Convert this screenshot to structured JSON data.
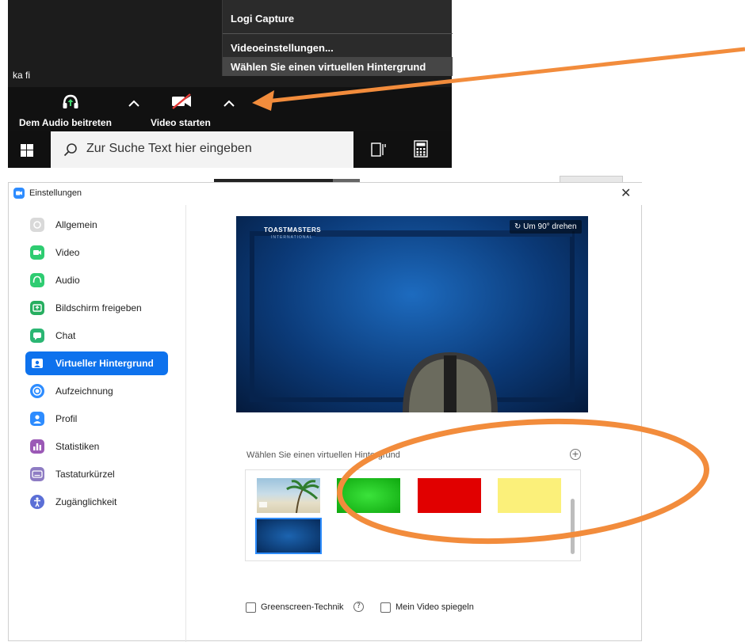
{
  "zoom_menu": {
    "items": [
      "Logi Capture",
      "Videoeinstellungen...",
      "Wählen Sie einen virtuellen Hintergrund"
    ]
  },
  "participant_name": "ka fi",
  "toolbar": {
    "audio_label": "Dem Audio beitreten",
    "video_label": "Video starten"
  },
  "taskbar": {
    "search_placeholder": "Zur Suche Text hier eingeben"
  },
  "window": {
    "title": "Einstellungen",
    "close": "✕"
  },
  "sidebar": {
    "items": [
      {
        "label": "Allgemein",
        "icon": "gear-icon",
        "color": "#d9d9d9"
      },
      {
        "label": "Video",
        "icon": "video-icon",
        "color": "#2ecc71"
      },
      {
        "label": "Audio",
        "icon": "headphones-icon",
        "color": "#2ecc71"
      },
      {
        "label": "Bildschirm freigeben",
        "icon": "share-screen-icon",
        "color": "#27ae60"
      },
      {
        "label": "Chat",
        "icon": "chat-icon",
        "color": "#2bb673"
      },
      {
        "label": "Virtueller Hintergrund",
        "icon": "background-icon",
        "color": "#ffffff"
      },
      {
        "label": "Aufzeichnung",
        "icon": "record-icon",
        "color": "#2d8cff"
      },
      {
        "label": "Profil",
        "icon": "profile-icon",
        "color": "#2d8cff"
      },
      {
        "label": "Statistiken",
        "icon": "statistics-icon",
        "color": "#9b59b6"
      },
      {
        "label": "Tastaturkürzel",
        "icon": "keyboard-icon",
        "color": "#8e7cc3"
      },
      {
        "label": "Zugänglichkeit",
        "icon": "accessibility-icon",
        "color": "#5b6fd6"
      }
    ],
    "active": "Virtueller Hintergrund"
  },
  "preview": {
    "logo": "TOASTMASTERS",
    "logo_sub": "INTERNATIONAL",
    "rotate_label": "Um 90° drehen"
  },
  "backgrounds": {
    "label": "Wählen Sie einen virtuellen Hintergrund",
    "add": "+",
    "thumbnails": [
      {
        "name": "beach",
        "color": "#8fb7cf"
      },
      {
        "name": "green",
        "color": "#16c216"
      },
      {
        "name": "red",
        "color": "#e10000"
      },
      {
        "name": "yellow",
        "color": "#fbf07a"
      },
      {
        "name": "toastmasters-blue",
        "color": "#0b4a8a"
      }
    ]
  },
  "options": {
    "greenscreen_label": "Greenscreen-Technik",
    "help": "?",
    "mirror_label": "Mein Video spiegeln"
  },
  "colors": {
    "accent": "#0e72ed",
    "annotation": "#f28c3c"
  }
}
